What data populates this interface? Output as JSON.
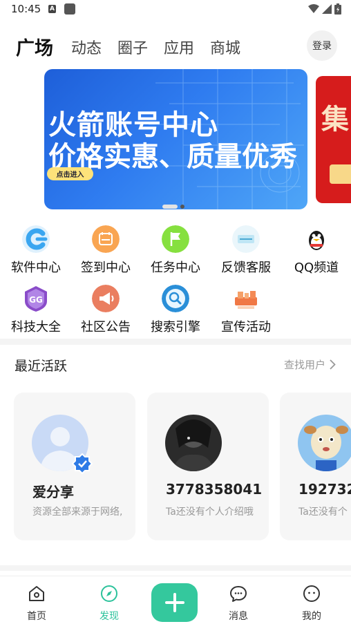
{
  "status_bar": {
    "time": "10:45",
    "a_badge": "A"
  },
  "top_tabs": [
    {
      "label": "广场",
      "active": true
    },
    {
      "label": "动态",
      "active": false
    },
    {
      "label": "圈子",
      "active": false
    },
    {
      "label": "应用",
      "active": false
    },
    {
      "label": "商城",
      "active": false
    }
  ],
  "login_label": "登录",
  "banner": {
    "line1": "火箭账号中心",
    "line2": "价格实惠、质量优秀",
    "button": "点击进入",
    "page_indicator": {
      "current": 1,
      "total": 2
    }
  },
  "shortcuts": [
    {
      "label": "软件中心",
      "icon": "software-center-icon",
      "color": "#3aa6f0"
    },
    {
      "label": "签到中心",
      "icon": "checkin-calendar-icon",
      "color": "#f7a14a"
    },
    {
      "label": "任务中心",
      "icon": "task-flag-icon",
      "color": "#7fdc3a"
    },
    {
      "label": "反馈客服",
      "icon": "feedback-icon",
      "color": "#8fd4f0"
    },
    {
      "label": "QQ频道",
      "icon": "qq-penguin-icon",
      "color": "#222222"
    },
    {
      "label": "科技大全",
      "icon": "game-guardian-icon",
      "color": "#8a4cc9"
    },
    {
      "label": "社区公告",
      "icon": "megaphone-icon",
      "color": "#e87a5d"
    },
    {
      "label": "搜索引擎",
      "icon": "search-globe-icon",
      "color": "#2a8fd8"
    },
    {
      "label": "宣传活动",
      "icon": "event-gift-icon",
      "color": "#f07845"
    }
  ],
  "recent": {
    "title": "最近活跃",
    "more": "查找用户",
    "users": [
      {
        "name": "爱分享",
        "bio": "资源全部来源于网络,",
        "verified": true,
        "avatar": "default-user-avatar"
      },
      {
        "name": "3778358041",
        "bio": "Ta还没有个人介绍哦",
        "verified": false,
        "avatar": "dark-anime-avatar"
      },
      {
        "name": "192732",
        "bio": "Ta还没有个",
        "verified": false,
        "avatar": "cartoon-dog-avatar"
      }
    ]
  },
  "bottom_nav": [
    {
      "label": "首页",
      "icon": "home-icon",
      "active": false
    },
    {
      "label": "发现",
      "icon": "compass-icon",
      "active": true
    },
    {
      "label": "消息",
      "icon": "message-icon",
      "active": false
    },
    {
      "label": "我的",
      "icon": "profile-icon",
      "active": false
    }
  ],
  "colors": {
    "accent": "#34c89d",
    "accent_text": "#2bc29b",
    "banner_blue": "#2f7cf0"
  }
}
